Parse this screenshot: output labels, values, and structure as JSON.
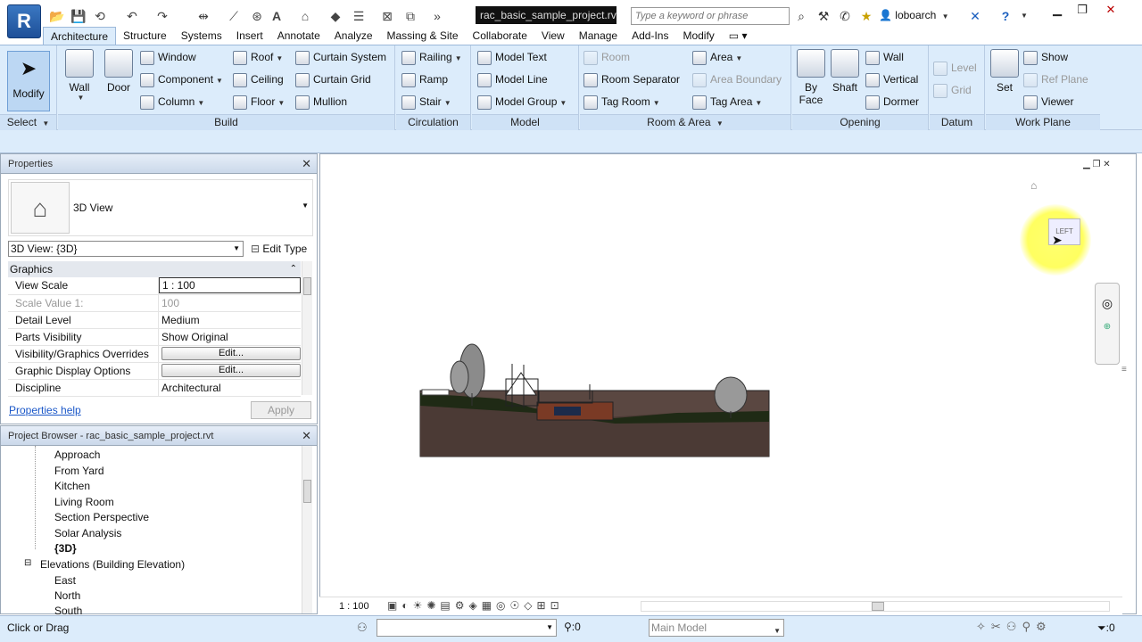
{
  "title_bar": {
    "doc_title": "rac_basic_sample_project.rvt",
    "search_placeholder": "Type a keyword or phrase",
    "user": "loboarch"
  },
  "tabs": [
    "Architecture",
    "Structure",
    "Systems",
    "Insert",
    "Annotate",
    "Analyze",
    "Massing & Site",
    "Collaborate",
    "View",
    "Manage",
    "Add-Ins",
    "Modify"
  ],
  "active_tab": "Architecture",
  "ribbon": {
    "select": {
      "modify": "Modify",
      "footer": "Select"
    },
    "build": {
      "wall": "Wall",
      "door": "Door",
      "window": "Window",
      "component": "Component",
      "column": "Column",
      "roof": "Roof",
      "ceiling": "Ceiling",
      "floor": "Floor",
      "curtain_system": "Curtain System",
      "curtain_grid": "Curtain Grid",
      "mullion": "Mullion",
      "footer": "Build"
    },
    "circulation": {
      "railing": "Railing",
      "ramp": "Ramp",
      "stair": "Stair",
      "footer": "Circulation"
    },
    "model": {
      "model_text": "Model Text",
      "model_line": "Model Line",
      "model_group": "Model Group",
      "footer": "Model"
    },
    "room_area": {
      "room": "Room",
      "room_separator": "Room Separator",
      "tag_room": "Tag Room",
      "area": "Area",
      "area_boundary": "Area Boundary",
      "tag_area": "Tag Area",
      "footer": "Room & Area"
    },
    "opening": {
      "by_face": "By",
      "by_face2": "Face",
      "shaft": "Shaft",
      "wall": "Wall",
      "vertical": "Vertical",
      "dormer": "Dormer",
      "footer": "Opening"
    },
    "datum": {
      "level": "Level",
      "grid": "Grid",
      "footer": "Datum"
    },
    "work_plane": {
      "set": "Set",
      "show": "Show",
      "ref_plane": "Ref Plane",
      "viewer": "Viewer",
      "footer": "Work Plane"
    }
  },
  "properties": {
    "header": "Properties",
    "type_name": "3D View",
    "view_selector": "3D View: {3D}",
    "edit_type": "Edit Type",
    "group": "Graphics",
    "rows": [
      {
        "label": "View Scale",
        "value": "1 : 100"
      },
      {
        "label": "Scale Value    1:",
        "value": "100"
      },
      {
        "label": "Detail Level",
        "value": "Medium"
      },
      {
        "label": "Parts Visibility",
        "value": "Show Original"
      },
      {
        "label": "Visibility/Graphics Overrides",
        "value": "Edit..."
      },
      {
        "label": "Graphic Display Options",
        "value": "Edit..."
      },
      {
        "label": "Discipline",
        "value": "Architectural"
      }
    ],
    "help_link": "Properties help",
    "apply": "Apply"
  },
  "browser": {
    "header": "Project Browser - rac_basic_sample_project.rvt",
    "items": [
      "Approach",
      "From Yard",
      "Kitchen",
      "Living Room",
      "Section Perspective",
      "Solar Analysis",
      "{3D}"
    ],
    "elevations_group": "Elevations (Building Elevation)",
    "elevations": [
      "East",
      "North",
      "South"
    ]
  },
  "view": {
    "scale": "1 : 100",
    "viewcube_face": "LEFT"
  },
  "status": {
    "text": "Click or Drag",
    "filter_count": ":0",
    "sel_count": ":0",
    "main_model": "Main Model"
  }
}
